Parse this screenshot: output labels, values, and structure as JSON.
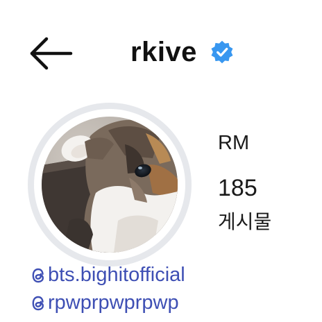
{
  "header": {
    "back_icon": "arrow-left-icon",
    "username": "rkive",
    "verified_icon": "verified-badge-icon",
    "verified_color": "#3897f0"
  },
  "profile": {
    "avatar_icon": "cat-photo",
    "name": "RM",
    "post_count": "185",
    "post_label": "게시물"
  },
  "links": [
    {
      "icon": "threads-icon",
      "handle": "bts.bighitofficial"
    },
    {
      "icon": "threads-icon",
      "handle": "rpwprpwprpwp"
    }
  ],
  "colors": {
    "text": "#111111",
    "link": "#3e4fb4",
    "ring": "#e6e8ec"
  }
}
